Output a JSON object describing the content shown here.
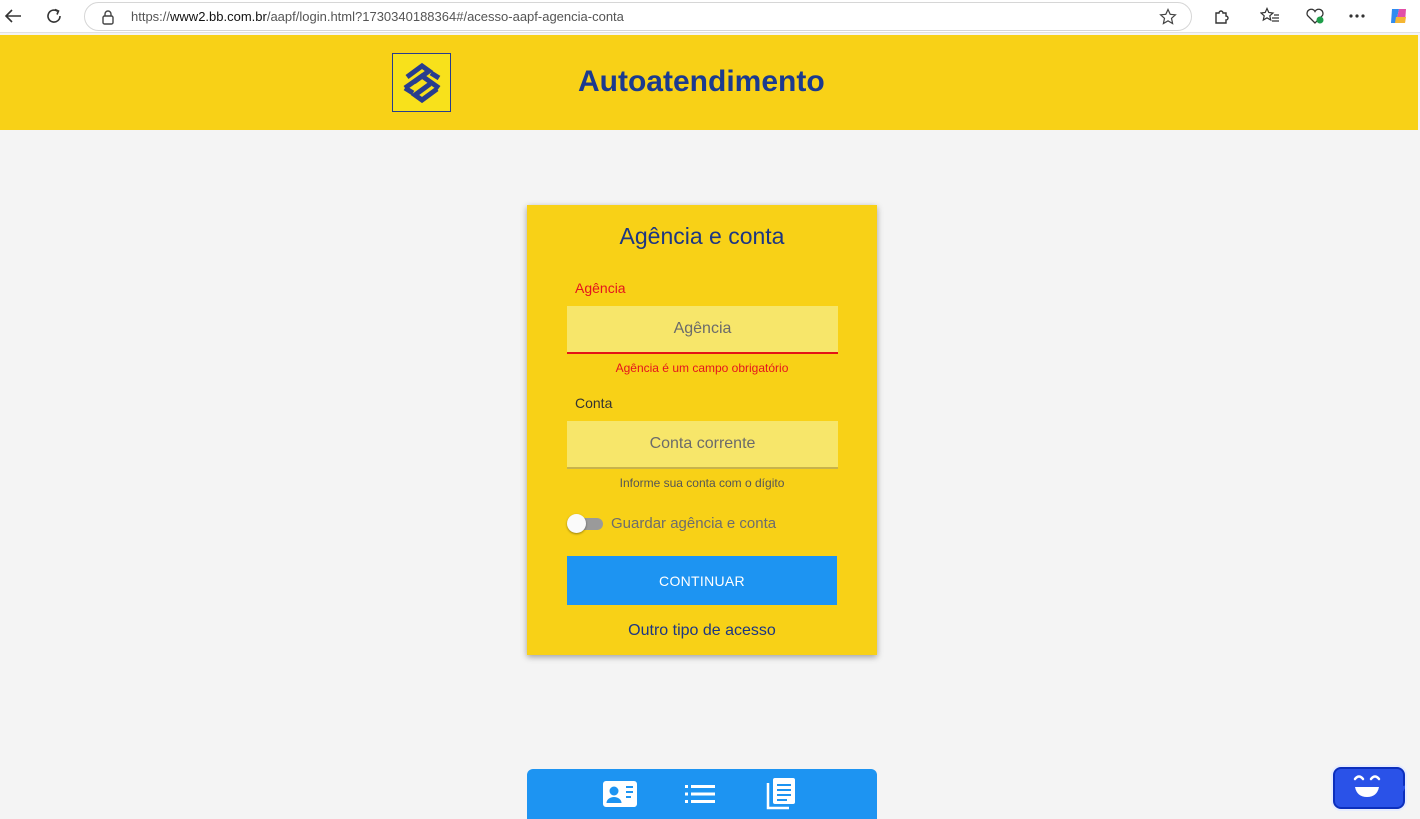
{
  "browser": {
    "url_prefix": "https://",
    "url_host": "www2.bb.com.br",
    "url_path": "/aapf/login.html?1730340188364#/acesso-aapf-agencia-conta"
  },
  "header": {
    "title": "Autoatendimento",
    "logo_color": "#283d8e"
  },
  "form": {
    "title": "Agência e conta",
    "agencia": {
      "label": "Agência",
      "placeholder": "Agência",
      "error": "Agência é um campo obrigatório"
    },
    "conta": {
      "label": "Conta",
      "placeholder": "Conta corrente",
      "hint": "Informe sua conta com o dígito"
    },
    "remember_label": "Guardar agência e conta",
    "remember_checked": false,
    "continue_label": "CONTINUAR",
    "other_access_label": "Outro tipo de acesso"
  },
  "bottom_nav": {
    "icons": [
      "contact-card-icon",
      "list-icon",
      "documents-icon"
    ]
  },
  "colors": {
    "brand_yellow": "#f8d117",
    "brand_blue": "#1c3683",
    "action_blue": "#1d94f2",
    "error_red": "#e4141e"
  }
}
